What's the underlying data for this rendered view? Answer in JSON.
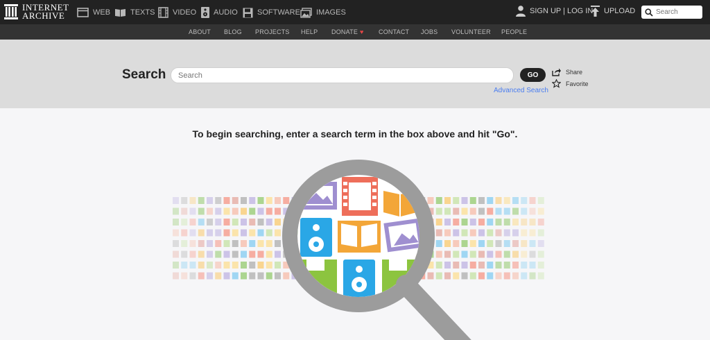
{
  "brand": {
    "line1": "INTERNET",
    "line2": "ARCHIVE"
  },
  "topnav": [
    {
      "label": "WEB",
      "icon": "web-icon"
    },
    {
      "label": "TEXTS",
      "icon": "book-icon"
    },
    {
      "label": "VIDEO",
      "icon": "film-icon"
    },
    {
      "label": "AUDIO",
      "icon": "speaker-icon"
    },
    {
      "label": "SOFTWARE",
      "icon": "floppy-disk-icon"
    },
    {
      "label": "IMAGES",
      "icon": "image-icon"
    }
  ],
  "account": {
    "signup_login": "SIGN UP | LOG IN",
    "upload": "UPLOAD"
  },
  "top_search": {
    "placeholder": "Search"
  },
  "subnav": [
    "ABOUT",
    "BLOG",
    "PROJECTS",
    "HELP",
    "DONATE",
    "CONTACT",
    "JOBS",
    "VOLUNTEER",
    "PEOPLE"
  ],
  "search": {
    "title": "Search",
    "placeholder": "Search",
    "go_label": "GO",
    "advanced_link": "Advanced Search",
    "share_label": "Share",
    "favorite_label": "Favorite"
  },
  "instruction": "To begin searching, enter a search term in the box above and hit \"Go\".",
  "colors": {
    "topbar": "#222222",
    "subnav": "#333333",
    "band": "#dcdcdc",
    "link": "#4a7df0",
    "heart": "#e64646"
  }
}
